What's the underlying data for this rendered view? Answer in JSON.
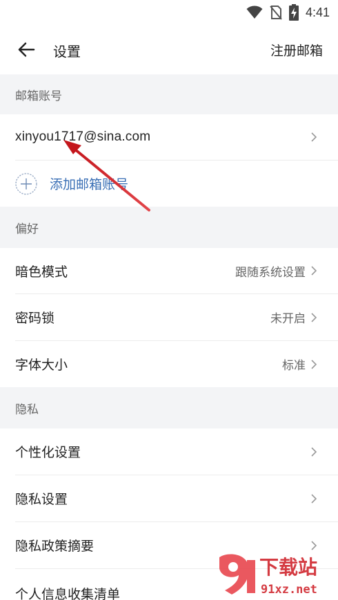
{
  "status_bar": {
    "time": "4:41"
  },
  "header": {
    "title": "设置",
    "action": "注册邮箱"
  },
  "sections": {
    "mail_accounts": {
      "title": "邮箱账号",
      "account": "xinyou1717@sina.com",
      "add_label": "添加邮箱账号"
    },
    "preferences": {
      "title": "偏好",
      "items": [
        {
          "label": "暗色模式",
          "value": "跟随系统设置"
        },
        {
          "label": "密码锁",
          "value": "未开启"
        },
        {
          "label": "字体大小",
          "value": "标准"
        }
      ]
    },
    "privacy": {
      "title": "隐私",
      "items": [
        {
          "label": "个性化设置"
        },
        {
          "label": "隐私设置"
        },
        {
          "label": "隐私政策摘要"
        },
        {
          "label": "个人信息收集清单"
        }
      ]
    }
  },
  "watermark": {
    "brand": "下载站",
    "domain": "91xz.net"
  },
  "colors": {
    "accent": "#3a6fb5",
    "section_bg": "#f3f4f6",
    "annotation_arrow": "#d3262b"
  }
}
